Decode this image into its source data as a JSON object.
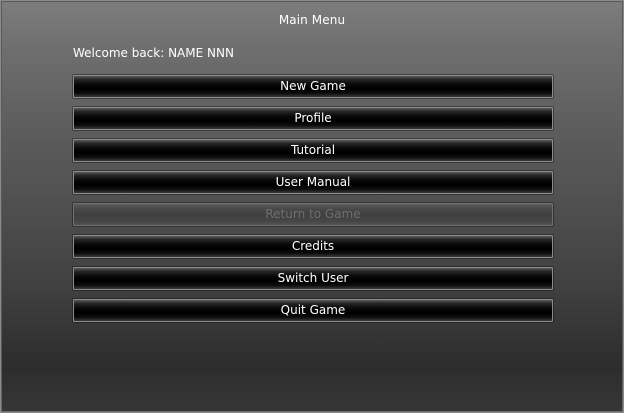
{
  "window": {
    "title": "Main Menu"
  },
  "welcome": {
    "text": "Welcome back: NAME NNN"
  },
  "menu": {
    "new_game": "New Game",
    "profile": "Profile",
    "tutorial": "Tutorial",
    "user_manual": "User Manual",
    "return_to_game": "Return to Game",
    "credits": "Credits",
    "switch_user": "Switch User",
    "quit_game": "Quit Game"
  },
  "state": {
    "return_to_game_enabled": false
  }
}
